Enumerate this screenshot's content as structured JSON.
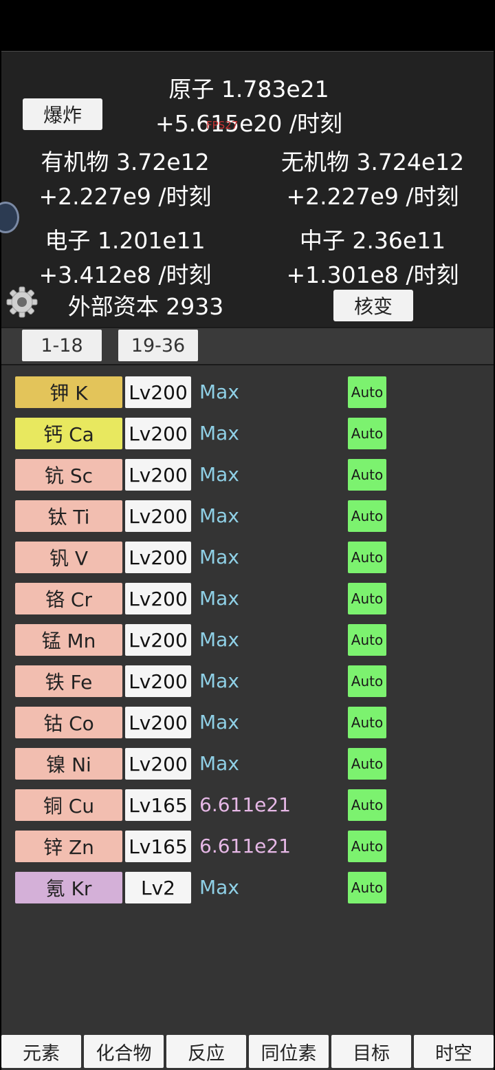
{
  "header": {
    "atoms": "原子 1.783e21",
    "atoms_rate": "+5.615e20 /时刻",
    "explode_label": "爆炸",
    "fps": "FPS27",
    "organic": "有机物 3.72e12",
    "organic_rate": "+2.227e9 /时刻",
    "inorganic": "无机物 3.724e12",
    "inorganic_rate": "+2.227e9 /时刻",
    "electrons": "电子 1.201e11",
    "electrons_rate": "+3.412e8 /时刻",
    "neutrons": "中子 2.36e11",
    "neutrons_rate": "+1.301e8 /时刻",
    "external_capital": "外部资本 2933",
    "fission_label": "核变"
  },
  "range_tabs": [
    "1-18",
    "19-36"
  ],
  "elements": [
    {
      "name": "钾 K",
      "level": "Lv200",
      "cost": "Max",
      "auto": "Auto",
      "color": "#e3c45a",
      "cost_color": "#8fd0e6"
    },
    {
      "name": "钙 Ca",
      "level": "Lv200",
      "cost": "Max",
      "auto": "Auto",
      "color": "#e8e85f",
      "cost_color": "#8fd0e6"
    },
    {
      "name": "钪 Sc",
      "level": "Lv200",
      "cost": "Max",
      "auto": "Auto",
      "color": "#f2beb0",
      "cost_color": "#8fd0e6"
    },
    {
      "name": "钛 Ti",
      "level": "Lv200",
      "cost": "Max",
      "auto": "Auto",
      "color": "#f2beb0",
      "cost_color": "#8fd0e6"
    },
    {
      "name": "钒 V",
      "level": "Lv200",
      "cost": "Max",
      "auto": "Auto",
      "color": "#f2beb0",
      "cost_color": "#8fd0e6"
    },
    {
      "name": "铬 Cr",
      "level": "Lv200",
      "cost": "Max",
      "auto": "Auto",
      "color": "#f2beb0",
      "cost_color": "#8fd0e6"
    },
    {
      "name": "锰 Mn",
      "level": "Lv200",
      "cost": "Max",
      "auto": "Auto",
      "color": "#f2beb0",
      "cost_color": "#8fd0e6"
    },
    {
      "name": "铁 Fe",
      "level": "Lv200",
      "cost": "Max",
      "auto": "Auto",
      "color": "#f2beb0",
      "cost_color": "#8fd0e6"
    },
    {
      "name": "钴 Co",
      "level": "Lv200",
      "cost": "Max",
      "auto": "Auto",
      "color": "#f2beb0",
      "cost_color": "#8fd0e6"
    },
    {
      "name": "镍 Ni",
      "level": "Lv200",
      "cost": "Max",
      "auto": "Auto",
      "color": "#f2beb0",
      "cost_color": "#8fd0e6"
    },
    {
      "name": "铜 Cu",
      "level": "Lv165",
      "cost": "6.611e21",
      "auto": "Auto",
      "color": "#f2beb0",
      "cost_color": "#e6b8e6"
    },
    {
      "name": "锌 Zn",
      "level": "Lv165",
      "cost": "6.611e21",
      "auto": "Auto",
      "color": "#f2beb0",
      "cost_color": "#e6b8e6"
    },
    {
      "name": "氪 Kr",
      "level": "Lv2",
      "cost": "Max",
      "auto": "Auto",
      "color": "#d4b0d8",
      "cost_color": "#8fd0e6"
    }
  ],
  "bottom_nav": [
    "元素",
    "化合物",
    "反应",
    "同位素",
    "目标",
    "时空"
  ],
  "icons": {
    "settings": "gear-icon",
    "floating": "floating-ball-icon"
  }
}
